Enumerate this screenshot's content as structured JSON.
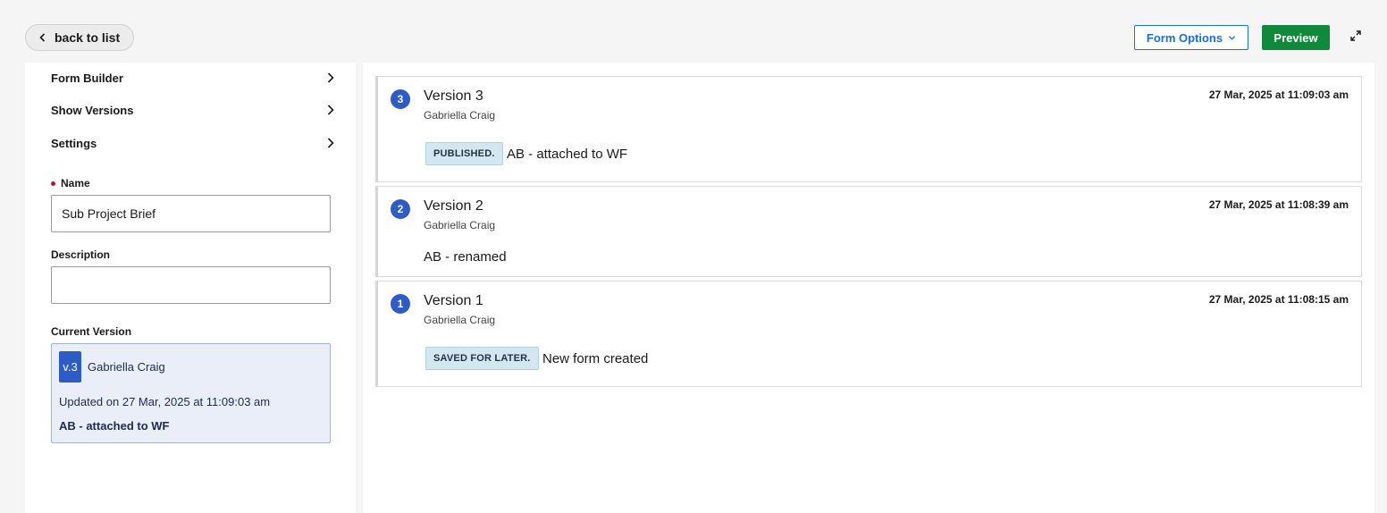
{
  "header": {
    "back_label": "back to list",
    "form_options_label": "Form Options",
    "preview_label": "Preview"
  },
  "sidebar": {
    "nav": [
      {
        "label": "Form Builder"
      },
      {
        "label": "Show Versions"
      },
      {
        "label": "Settings"
      }
    ],
    "name_label": "Name",
    "name_value": "Sub Project Brief",
    "description_label": "Description",
    "description_value": "",
    "current_version_label": "Current Version",
    "current_version": {
      "badge": "v.3",
      "author": "Gabriella Craig",
      "updated": "Updated on 27 Mar, 2025 at 11:09:03 am",
      "comment": "AB - attached to WF"
    }
  },
  "versions": [
    {
      "number": "3",
      "title": "Version 3",
      "author": "Gabriella Craig",
      "date": "27 Mar, 2025 at 11:09:03 am",
      "status": "PUBLISHED.",
      "comment": "AB - attached to WF"
    },
    {
      "number": "2",
      "title": "Version 2",
      "author": "Gabriella Craig",
      "date": "27 Mar, 2025 at 11:08:39 am",
      "status": "",
      "comment": "AB - renamed"
    },
    {
      "number": "1",
      "title": "Version 1",
      "author": "Gabriella Craig",
      "date": "27 Mar, 2025 at 11:08:15 am",
      "status": "SAVED FOR LATER.",
      "comment": "New form created"
    }
  ],
  "colors": {
    "accent": "#2d5cc6",
    "preview": "#0f8a3a",
    "link": "#1a6fd0",
    "status_bg": "#d4e7f1"
  }
}
